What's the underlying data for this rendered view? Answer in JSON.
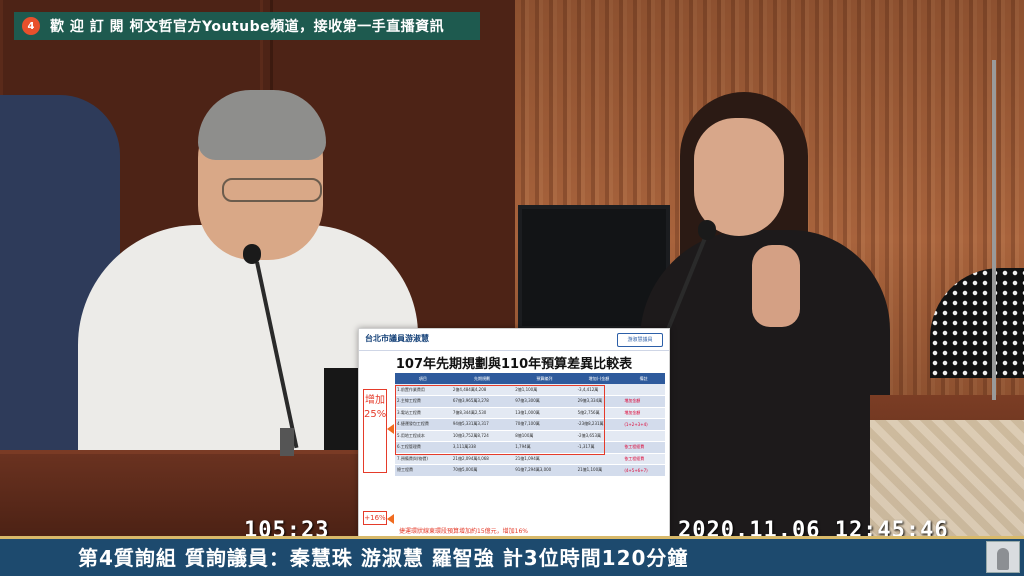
{
  "top_banner": {
    "logo_text": "4",
    "text": "歡 迎 訂 閱 柯文哲官方Youtube頻道，接收第一手直播資訊"
  },
  "poster": {
    "org": "台北市議員游淑慧",
    "logo_label": "游淑慧議員",
    "title": "107年先期規劃與110年預算差異比較表",
    "side_label": "增加25%",
    "badge": "+16%",
    "table_headers": [
      "項目",
      "先期規劃",
      "預算編列",
      "增加(-)金額",
      "備註"
    ],
    "table_rows": [
      [
        "1.前置作業費用",
        "2億4,484萬4,208",
        "2億1,100萬",
        "-3,4,412萬",
        ""
      ],
      [
        "2.主線工程費",
        "67億3,965萬3,278",
        "97億3,300萬",
        "29億3,334萬",
        "增加金額"
      ],
      [
        "3.電站工程費",
        "7億8,344萬2,530",
        "13億1,000萬",
        "5億2,756萬",
        "增加金額"
      ],
      [
        "4.捷運發包工程費",
        "94億5,331萬3,317",
        "70億7,100萬",
        "-23億8,231萬",
        "(1+2+3+4)"
      ],
      [
        "5.用地工程成本",
        "10億3,752萬8,724",
        "8億100萬",
        "-2億3,653萬",
        ""
      ],
      [
        "6.工程管理費",
        "3,111萬338",
        "1,794萬",
        "-1,317萬",
        "依工程經費"
      ],
      [
        "7.預備費與(物價)",
        "21億2,094萬4,068",
        "21億1,094萬",
        "",
        "依工程經費"
      ],
      [
        "總工程費",
        "70億5,000萬",
        "91億7,294萬3,000",
        "21億1,100萬",
        "(4+5+6+7)"
      ]
    ],
    "footer": "捷運環狀線東環段預算增加約15億元，增加16%"
  },
  "timecode_left": "105:23",
  "timecode_right": "2020.11.06 12:45:46",
  "bottom_caption": "第4質詢組  質詢議員：秦慧珠  游淑慧  羅智強   計3位時間120分鐘",
  "colors": {
    "banner_bg": "#1e5a4f",
    "bottom_bar_bg": "#1d4a6e",
    "bottom_bar_accent": "#d8b96a",
    "poster_accent": "#e53b2a",
    "table_header": "#2e5a9c"
  }
}
